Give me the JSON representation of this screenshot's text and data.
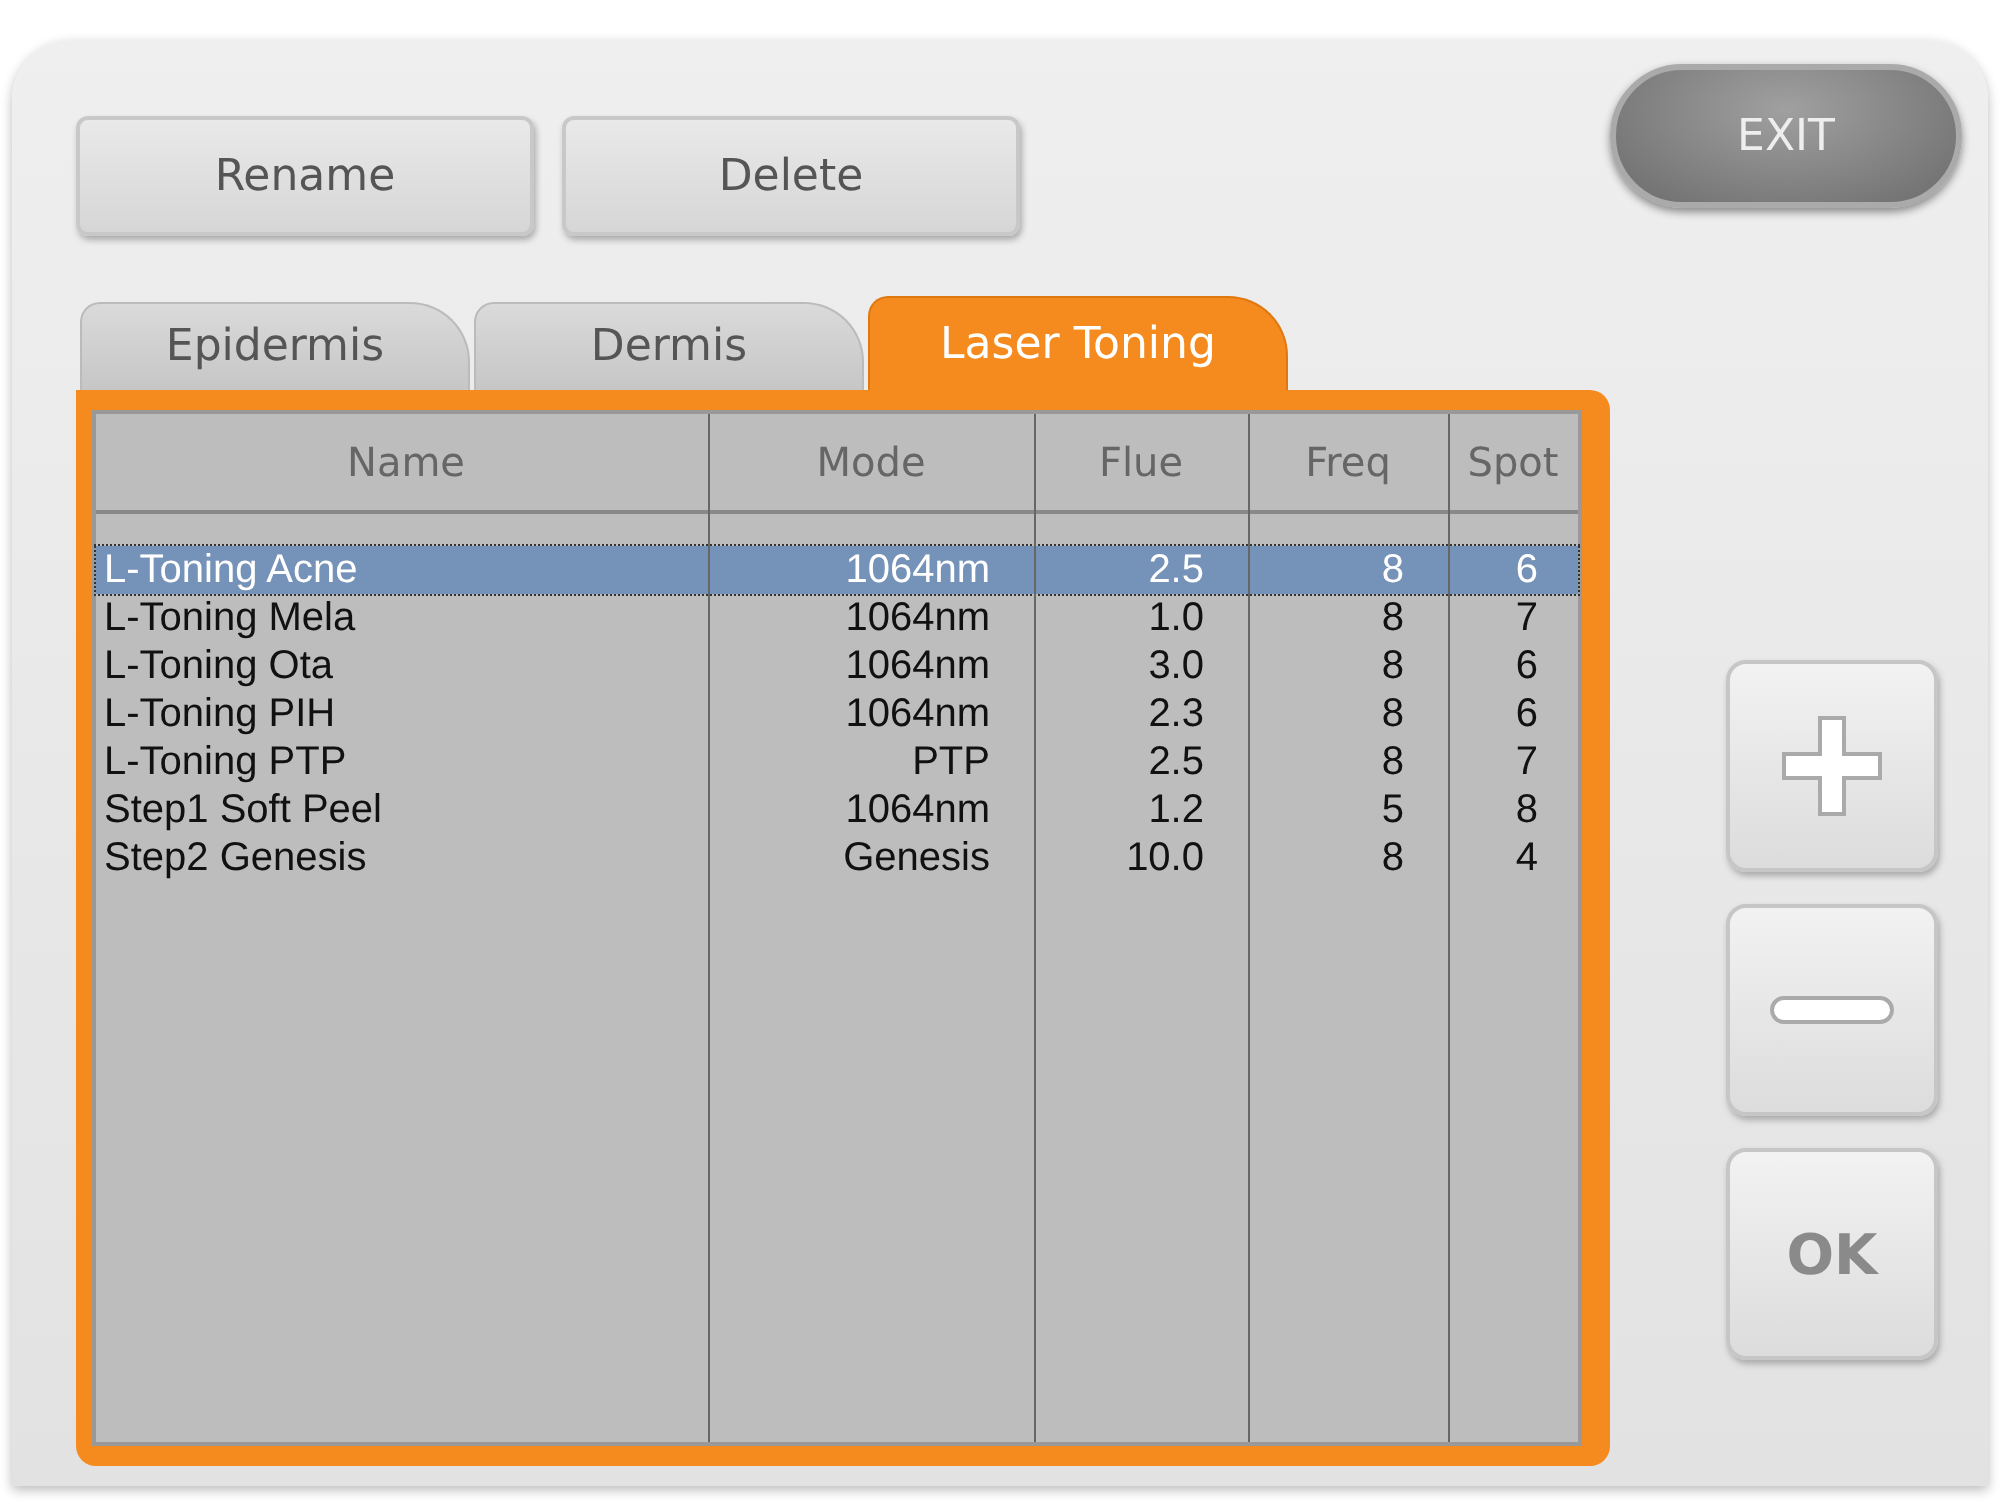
{
  "toolbar": {
    "buttons": [
      "Rename",
      "Delete"
    ]
  },
  "exit_button": "EXIT",
  "tabs": [
    {
      "label": "Epidermis",
      "selected": false
    },
    {
      "label": "Dermis",
      "selected": false
    },
    {
      "label": "Laser Toning",
      "selected": true
    }
  ],
  "table": {
    "columns": [
      "Name",
      "Mode",
      "Flue",
      "Freq",
      "Spot"
    ],
    "rows": [
      {
        "cells": [
          "L-Toning Acne",
          "1064nm",
          "2.5",
          "8",
          "6"
        ],
        "selected": true
      },
      {
        "cells": [
          "L-Toning Mela",
          "1064nm",
          "1.0",
          "8",
          "7"
        ],
        "selected": false
      },
      {
        "cells": [
          "L-Toning Ota",
          "1064nm",
          "3.0",
          "8",
          "6"
        ],
        "selected": false
      },
      {
        "cells": [
          "L-Toning PIH",
          "1064nm",
          "2.3",
          "8",
          "6"
        ],
        "selected": false
      },
      {
        "cells": [
          "L-Toning PTP",
          "PTP",
          "2.5",
          "8",
          "7"
        ],
        "selected": false
      },
      {
        "cells": [
          "Step1 Soft Peel",
          "1064nm",
          "1.2",
          "5",
          "8"
        ],
        "selected": false
      },
      {
        "cells": [
          "Step2 Genesis",
          "Genesis",
          "10.0",
          "8",
          "4"
        ],
        "selected": false
      }
    ]
  },
  "side_buttons": [
    {
      "kind": "plus"
    },
    {
      "kind": "minus"
    },
    {
      "kind": "text",
      "label": "OK"
    }
  ]
}
